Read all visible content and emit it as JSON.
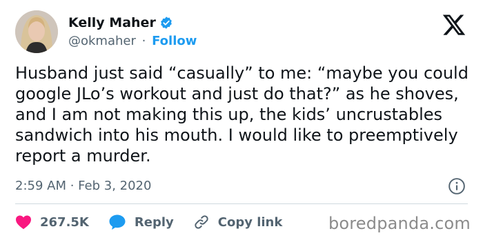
{
  "author": {
    "name": "Kelly Maher",
    "handle": "@okmaher",
    "separator": "·",
    "follow_label": "Follow"
  },
  "tweet": {
    "text": "Husband just said “casually” to me: “maybe you could google JLo’s workout and just do that?” as he shoves, and I am not making this up, the kids’ uncrustables sandwich into his mouth. I would like to preemptively report a murder.",
    "timestamp": "2:59 AM · Feb 3, 2020"
  },
  "actions": {
    "likes": "267.5K",
    "reply_label": "Reply",
    "copy_link_label": "Copy link"
  },
  "watermark": "boredpanda.com",
  "icons": {
    "verified": "verified-badge-icon",
    "brand": "x-logo-icon",
    "info": "info-icon",
    "like": "heart-icon",
    "reply": "speech-bubble-icon",
    "link": "link-icon"
  },
  "colors": {
    "accent": "#1d9bf0",
    "like": "#f91880",
    "text": "#0f1419",
    "secondary": "#536471"
  }
}
